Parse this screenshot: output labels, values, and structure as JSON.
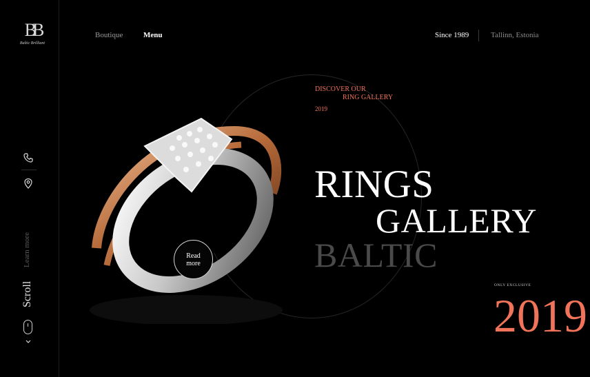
{
  "brand": {
    "monogram": "BB",
    "name": "Baltic Brilliant"
  },
  "nav": {
    "boutique": "Boutique",
    "menu": "Menu"
  },
  "header": {
    "since": "Since 1989",
    "location": "Tallinn, Estonia"
  },
  "sidebar": {
    "learn_more": "Learn more",
    "scroll": "Scroll"
  },
  "discover": {
    "line1": "DISCOVER OUR",
    "line2": "RING GALLERY",
    "year": "2019"
  },
  "hero": {
    "line1": "RINGS",
    "line2": "GALLERY",
    "line3": "BALTIC"
  },
  "cta": {
    "read_more": "Read more"
  },
  "exclusive": {
    "label": "ONLY EXCLUSIVE",
    "year": "2019"
  },
  "colors": {
    "accent": "#f0735a",
    "background": "#000000",
    "muted": "#4a4a4a"
  },
  "icons": [
    "phone-icon",
    "location-pin-icon",
    "mouse-icon",
    "chevron-down-icon"
  ]
}
